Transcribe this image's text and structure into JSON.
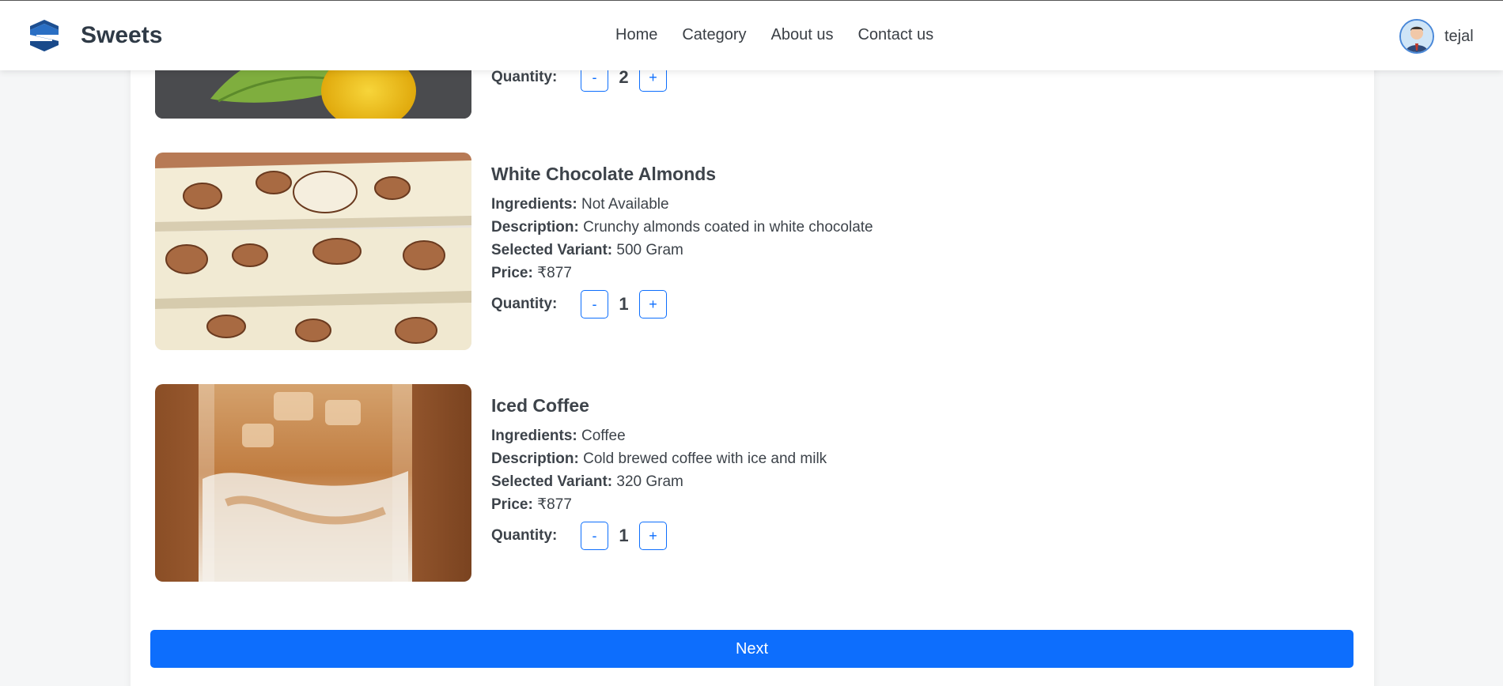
{
  "navbar": {
    "brand": "Sweets",
    "links": [
      "Home",
      "Category",
      "About us",
      "Contact us"
    ],
    "username": "tejal"
  },
  "cart": {
    "partial_item": {
      "quantity_label": "Quantity:",
      "quantity": "2",
      "minus": "-",
      "plus": "+"
    },
    "items": [
      {
        "name": "White Chocolate Almonds",
        "ingredients_label": "Ingredients:",
        "ingredients": "Not Available",
        "description_label": "Description:",
        "description": "Crunchy almonds coated in white chocolate",
        "variant_label": "Selected Variant:",
        "variant": "500 Gram",
        "price_label": "Price:",
        "price": "₹877",
        "quantity_label": "Quantity:",
        "quantity": "1",
        "minus": "-",
        "plus": "+"
      },
      {
        "name": "Iced Coffee",
        "ingredients_label": "Ingredients:",
        "ingredients": "Coffee",
        "description_label": "Description:",
        "description": "Cold brewed coffee with ice and milk",
        "variant_label": "Selected Variant:",
        "variant": "320 Gram",
        "price_label": "Price:",
        "price": "₹877",
        "quantity_label": "Quantity:",
        "quantity": "1",
        "minus": "-",
        "plus": "+"
      }
    ],
    "next_label": "Next"
  }
}
